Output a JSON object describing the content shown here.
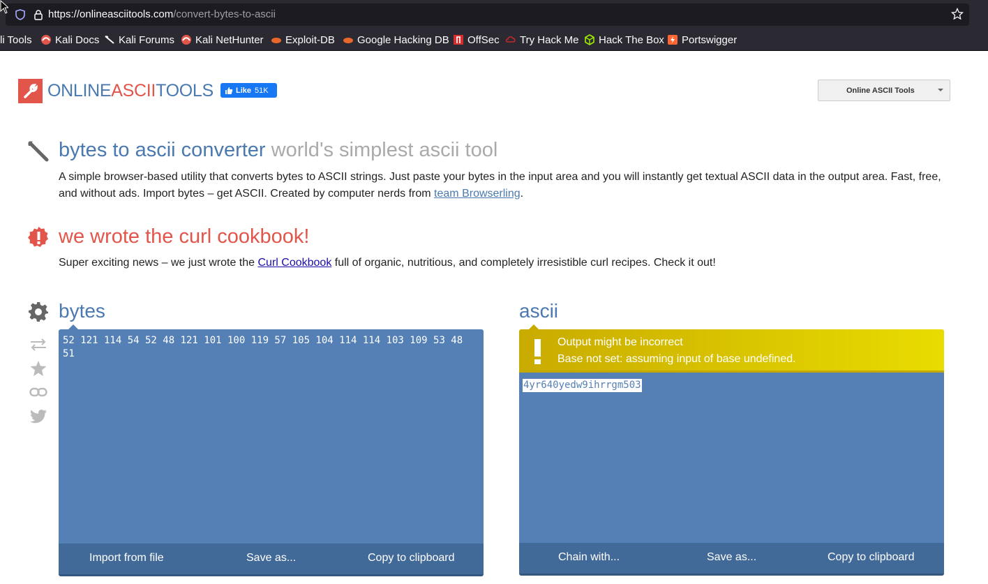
{
  "browser": {
    "url_host": "https://onlineasciitools.com",
    "url_path": "/convert-bytes-to-ascii",
    "bookmarks": [
      "li Tools",
      "Kali Docs",
      "Kali Forums",
      "Kali NetHunter",
      "Exploit-DB",
      "Google Hacking DB",
      "OffSec",
      "Try Hack Me",
      "Hack The Box",
      "Portswigger"
    ]
  },
  "header": {
    "logo_part1": "ONLINE",
    "logo_part2": "ASCII",
    "logo_part3": "TOOLS",
    "fb_like": "Like",
    "fb_count": "51K",
    "tools_dropdown": "Online ASCII Tools"
  },
  "intro": {
    "title": "bytes to ascii converter",
    "subtitle": "world's simplest ascii tool",
    "desc_before_link": "A simple browser-based utility that converts bytes to ASCII strings. Just paste your bytes in the input area and you will instantly get textual ASCII data in the output area. Fast, free, and without ads. Import bytes – get ASCII. Created by computer nerds from ",
    "desc_link": "team Browserling",
    "desc_after_link": "."
  },
  "news": {
    "title": "we wrote the curl cookbook!",
    "before_link": "Super exciting news – we just wrote the ",
    "link": "Curl Cookbook",
    "after_link": " full of organic, nutritious, and completely irresistible curl recipes. Check it out!"
  },
  "input_panel": {
    "title": "bytes",
    "value": "52 121 114 54 52 48 121 101 100 119 57 105 104 114 114 103 109 53 48 51",
    "buttons": [
      "Import from file",
      "Save as...",
      "Copy to clipboard"
    ]
  },
  "output_panel": {
    "title": "ascii",
    "warning_title": "Output might be incorrect",
    "warning_text": "Base not set: assuming input of base undefined.",
    "value": "4yr640yedw9ihrrgm503",
    "buttons": [
      "Chain with...",
      "Save as...",
      "Copy to clipboard"
    ]
  },
  "colors": {
    "brand_blue": "#4a79b0",
    "brand_red": "#e2554a",
    "panel_blue": "#5580b5",
    "warning_yellow": "#e8dc00"
  }
}
